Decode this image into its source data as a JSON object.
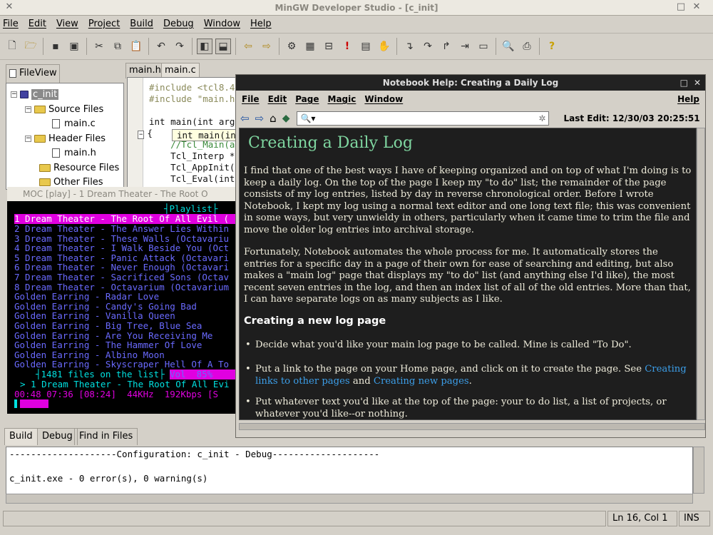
{
  "window_title": "MinGW Developer Studio - [c_init]",
  "menu": [
    "File",
    "Edit",
    "View",
    "Project",
    "Build",
    "Debug",
    "Window",
    "Help"
  ],
  "toolbar_icons": [
    "new-file-icon",
    "open-folder-icon",
    "save-icon",
    "save-all-icon",
    "cut-icon",
    "copy-icon",
    "paste-icon",
    "undo-icon",
    "redo-icon",
    "layout-left-icon",
    "layout-bottom-icon",
    "back-arrow-icon",
    "forward-arrow-icon",
    "compile-icon",
    "build-icon",
    "clean-icon",
    "stop-icon",
    "execute-icon",
    "hand-icon",
    "step-into-icon",
    "step-over-icon",
    "step-out-icon",
    "run-to-cursor-icon",
    "watch-icon",
    "preview-icon",
    "print-icon",
    "help-icon"
  ],
  "fileview": {
    "tab_label": "FileView",
    "project": "c_init",
    "items": [
      "Source Files",
      "main.c",
      "Header Files",
      "main.h",
      "Resource Files",
      "Other Files"
    ]
  },
  "editor": {
    "tabs": [
      "main.h",
      "main.c"
    ],
    "lines": [
      "#include <tcl8.4",
      "#include \"main.h",
      "",
      "int main(int arg",
      "{",
      "    //Tcl_Main(a",
      "    Tcl_Interp *",
      "    Tcl_AppInit(",
      "    Tcl_Eval(int"
    ],
    "tooltip": "int main(in"
  },
  "moc": {
    "title": "MOC [play] - 1 Dream Theater - The Root O",
    "header": "Playlist",
    "selected_row": "1 Dream Theater - The Root Of All Evil (",
    "octavarium_rows": [
      "2 Dream Theater - The Answer Lies Within",
      "3 Dream Theater - These Walls (Octavariu",
      "4 Dream Theater - I Walk Beside You (Oct",
      "5 Dream Theater - Panic Attack (Octavari",
      "6 Dream Theater - Never Enough (Octavari",
      "7 Dream Theater - Sacrificed Sons (Octav",
      "8 Dream Theater - Octavarium (Octavarium"
    ],
    "other_rows": [
      "Golden Earring - Radar Love",
      "Golden Earring - Candy's Going Bad",
      "Golden Earring - Vanilla Queen",
      "Golden Earring - Big Tree, Blue Sea",
      "Golden Earring - Are You Receiving Me",
      "Golden Earring - The Hammer Of Love",
      "Golden Earring - Albino Moon",
      "Golden Earring - Skyscraper Hell Of A To"
    ],
    "file_count": "1481 files on the list",
    "volume": "Vol  85%",
    "now_playing": "> 1 Dream Theater - The Root Of All Evi",
    "time_info": "00:48 07:36 [08:24]",
    "rate": "44KHz",
    "bitrate": "192Kbps",
    "flags": "[S"
  },
  "notebook": {
    "title": "Notebook Help: Creating a Daily Log",
    "menu": [
      "File",
      "Edit",
      "Page",
      "Magic",
      "Window"
    ],
    "help": "Help",
    "last_edit": "Last Edit: 12/30/03 20:25:51",
    "heading": "Creating a Daily Log",
    "para1": "I find that one of the best ways I have of keeping organized and on top of what I'm doing is to keep a daily log.  On the top of the page I keep my \"to do\" list; the remainder of the page consists of my log entries, listed by day in reverse chronological order.  Before I wrote Notebook, I kept my log using a normal text editor and one long text file; this was convenient in some ways, but very unwieldy in others, particularly when it came time to trim the file and move the older log entries into archival storage.",
    "para2": "Fortunately, Notebook automates the whole process for me.  It automatically stores the entries for a specific day in a page of their own for ease of searching and editing, but also makes a \"main log\" page that displays my \"to do\" list (and anything else I'd like), the most recent seven entries in the log, and then an index list of all of the old entries. More than that, I can have separate logs on as many subjects as I like.",
    "subheading": "Creating a new log page",
    "bullet1": "Decide what you'd like your main log page to be called.  Mine is called \"To Do\".",
    "bullet2_pre": "Put a link to the page on your Home page, and click on it to create the page.  See ",
    "link1": "Creating links to other pages",
    "bullet2_mid": " and ",
    "link2": "Creating new pages",
    "bullet2_post": ".",
    "bullet3": "Put whatever text you'd like at the top of the page: your to do list, a list of projects, or whatever you'd like--or nothing."
  },
  "output": {
    "tabs": [
      "Build",
      "Debug",
      "Find in Files"
    ],
    "line1": "--------------------Configuration: c_init - Debug--------------------",
    "line2": "c_init.exe - 0 error(s), 0 warning(s)"
  },
  "status": {
    "position": "Ln 16, Col 1",
    "mode": "INS"
  },
  "colors": {
    "link": "#3c9ee8",
    "heading": "#7fd6a0",
    "moc_cyan": "#00e0e0",
    "moc_magenta": "#e000e0",
    "moc_blue": "#6a6aff"
  }
}
